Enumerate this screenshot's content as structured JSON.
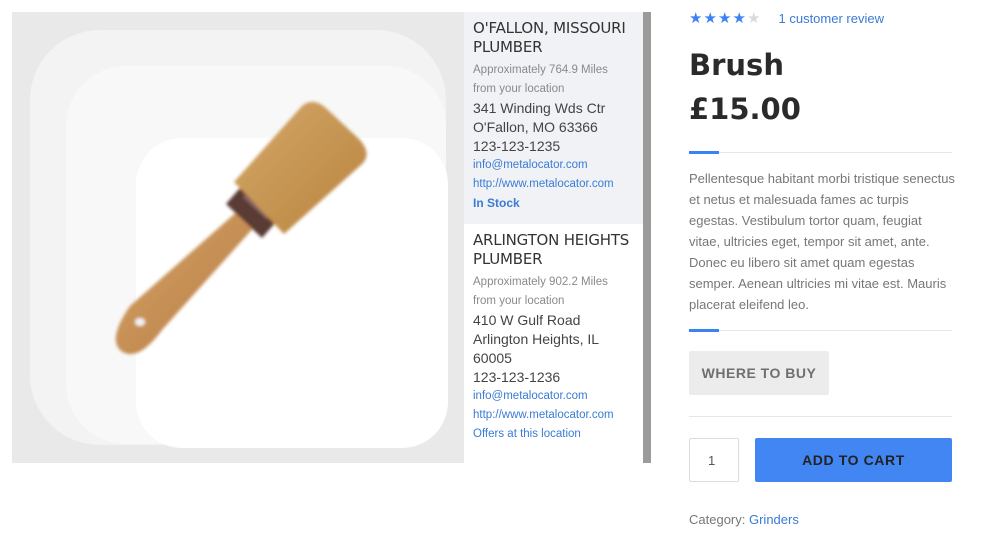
{
  "product": {
    "image_alt": "paint-brush",
    "title": "Brush",
    "price": "£15.00",
    "rating": {
      "value": 4,
      "max": 5,
      "review_link": "1 customer review"
    },
    "description": "Pellentesque habitant morbi tristique senectus et netus et malesuada fames ac turpis egestas. Vestibulum tortor quam, feugiat vitae, ultricies eget, tempor sit amet, ante. Donec eu libero sit amet quam egestas semper. Aenean ultricies mi vitae est. Mauris placerat eleifend leo.",
    "where_to_buy_label": "WHERE TO BUY",
    "quantity": "1",
    "add_to_cart_label": "ADD TO CART",
    "category_prefix": "Category: ",
    "category_link": "Grinders",
    "accent_color": "#3b82f6"
  },
  "locations": [
    {
      "title": "O'FALLON, MISSOURI PLUMBER",
      "distance_line1": "Approximately 764.9 Miles",
      "distance_line2": "from your location",
      "address_lines": [
        "341 Winding Wds Ctr",
        "O'Fallon, MO 63366"
      ],
      "phone": "123-123-1235",
      "email": "info@metalocator.com",
      "website": "http://www.metalocator.com",
      "status": "In Stock"
    },
    {
      "title": "ARLINGTON HEIGHTS PLUMBER",
      "distance_line1": "Approximately 902.2 Miles",
      "distance_line2": "from your location",
      "address_lines": [
        "410 W Gulf Road",
        "Arlington Heights, IL",
        "60005"
      ],
      "phone": "123-123-1236",
      "email": "info@metalocator.com",
      "website": "http://www.metalocator.com",
      "status": "Offers at this location"
    }
  ]
}
